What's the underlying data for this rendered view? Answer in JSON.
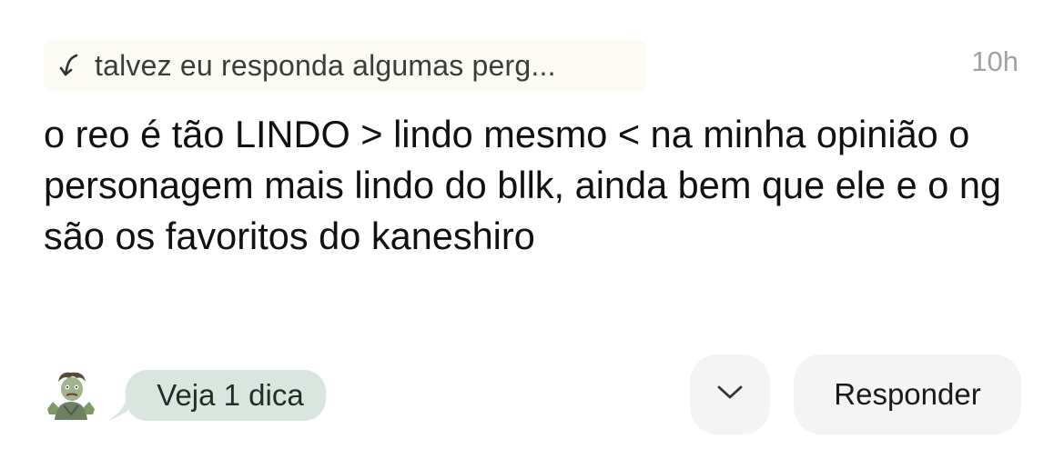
{
  "reply_context": {
    "icon": "reply-arrow-icon",
    "text": "talvez eu responda algumas perg..."
  },
  "timestamp": "10h",
  "message": {
    "text": "o reo é tão LINDO > lindo mesmo < na minha opinião o personagem mais lindo do bllk, ainda bem que ele e o ng são os favoritos do kaneshiro"
  },
  "author_avatar": {
    "icon": "zombie-emoji-avatar"
  },
  "tip_bubble": {
    "label": "Veja 1 dica",
    "color": "#d8e6df"
  },
  "actions": {
    "expand_icon": "chevron-down-icon",
    "reply_label": "Responder"
  }
}
